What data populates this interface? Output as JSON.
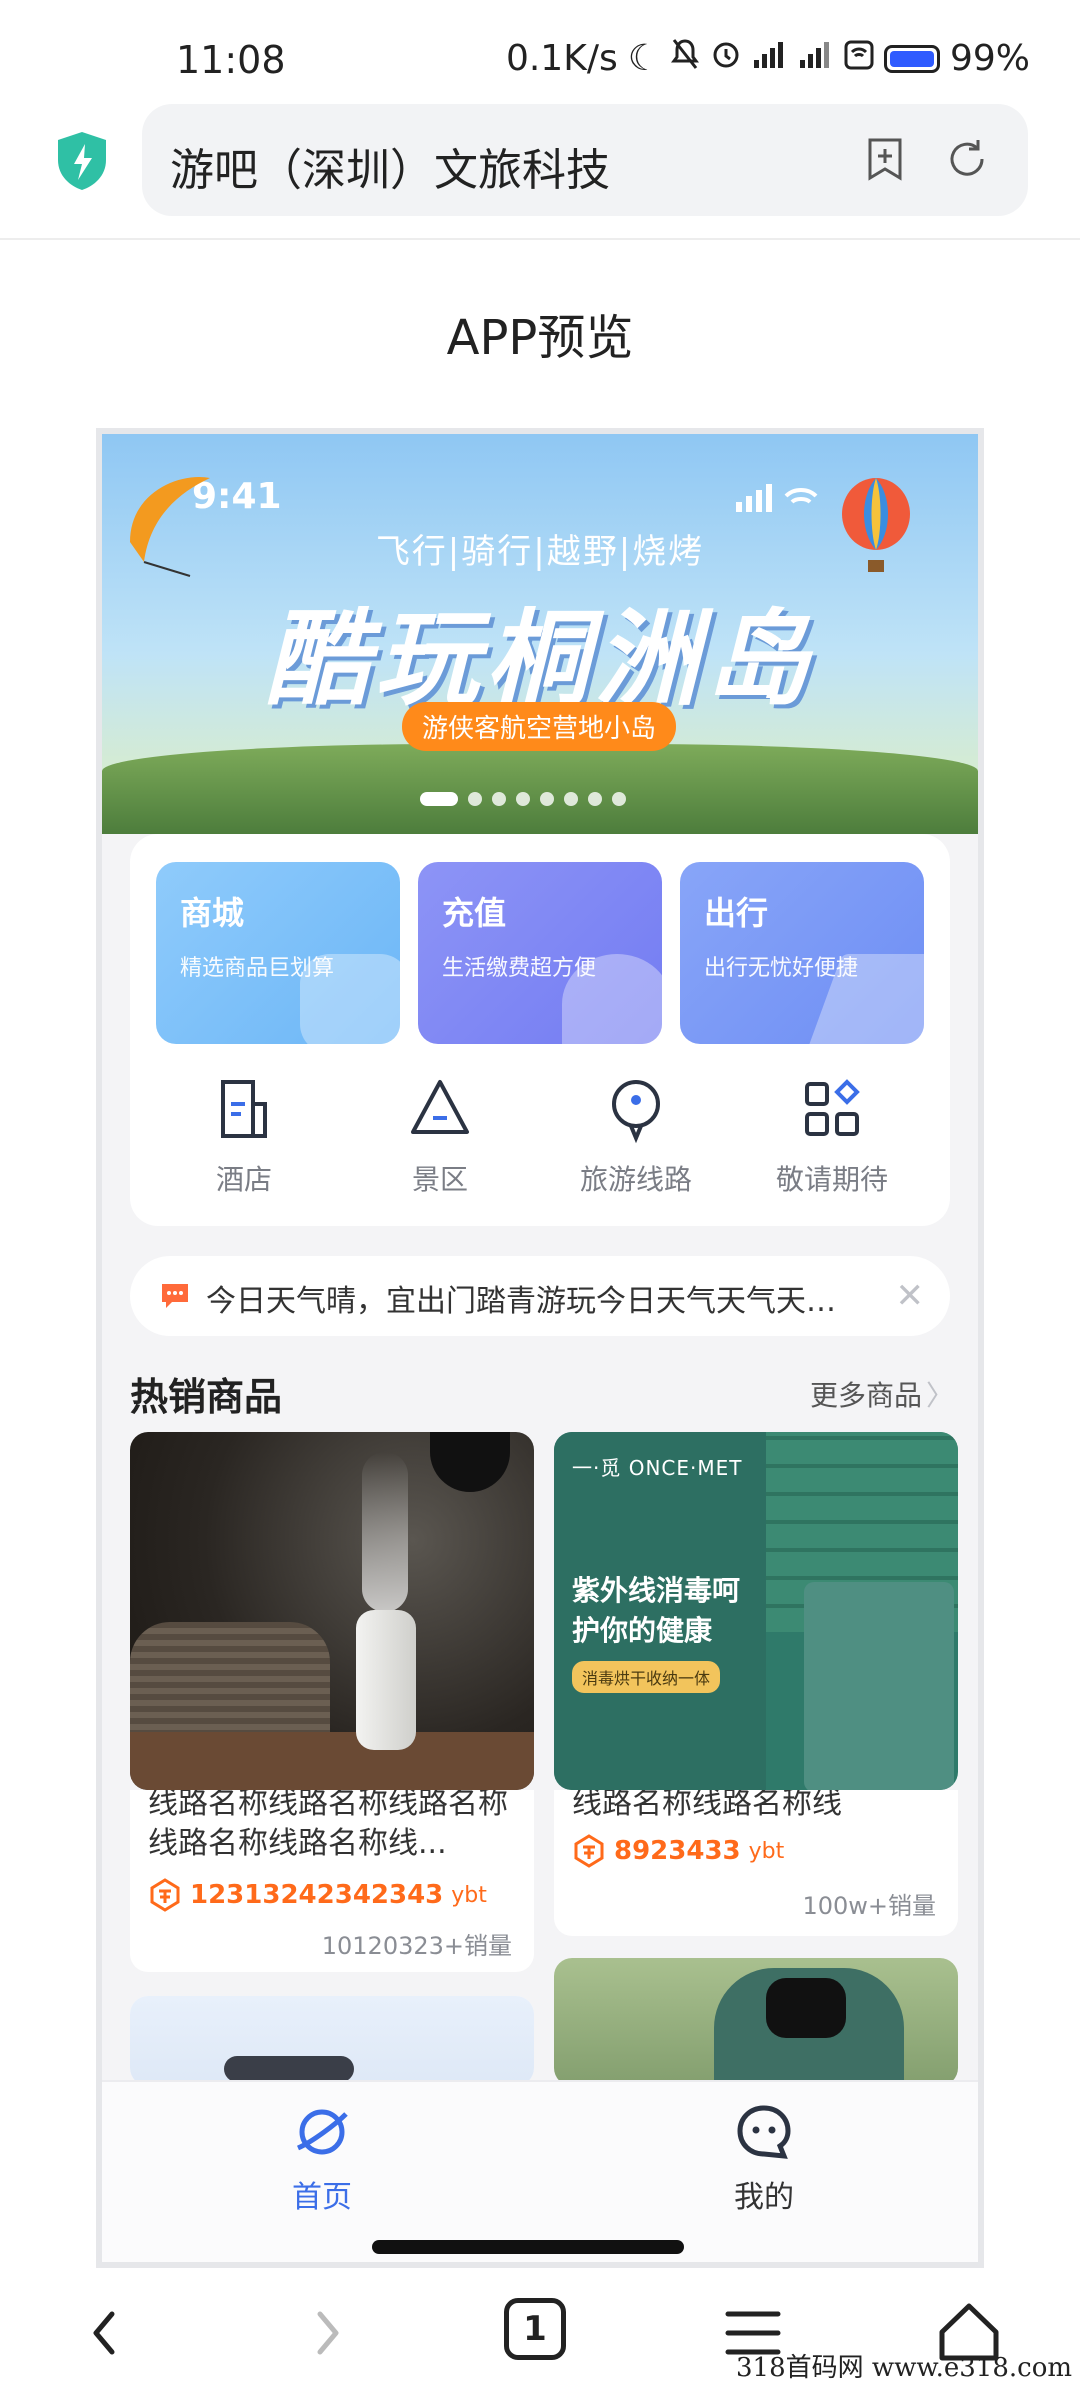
{
  "status_bar": {
    "time": "11:08",
    "net_speed": "0.1K/s",
    "battery": "99%"
  },
  "browser": {
    "url_title": "游吧（深圳）文旅科技",
    "tab_count": "1"
  },
  "page_title": "APP预览",
  "app": {
    "banner": {
      "time": "9:41",
      "subtitle": "飞行|骑行|越野|烧烤",
      "title": "酷玩桐洲岛",
      "tag": "游侠客航空营地小岛",
      "slide_count": 8,
      "active_slide": 1
    },
    "services": [
      {
        "title": "商城",
        "subtitle": "精选商品巨划算"
      },
      {
        "title": "充值",
        "subtitle": "生活缴费超方便"
      },
      {
        "title": "出行",
        "subtitle": "出行无忧好便捷"
      }
    ],
    "quick_links": [
      {
        "label": "酒店",
        "icon": "hotel-icon"
      },
      {
        "label": "景区",
        "icon": "scenic-icon"
      },
      {
        "label": "旅游线路",
        "icon": "route-icon"
      },
      {
        "label": "敬请期待",
        "icon": "apps-icon"
      }
    ],
    "notice": "今日天气晴，宜出门踏青游玩今日天气天气天天天…",
    "hot_section": {
      "title": "热销商品",
      "more": "更多商品"
    },
    "products": [
      {
        "name": "线路名称线路名称线路名称线路名称线路名称线...",
        "price": "12313242342343",
        "unit": "ybt",
        "sold": "10120323+销量"
      },
      {
        "name": "线路名称线路名称线",
        "price": "8923433",
        "unit": "ybt",
        "sold": "100w+销量",
        "image_brand": "一·觅 ONCE·MET",
        "image_headline": "紫外线消毒呵护你的健康",
        "image_pill": "消毒烘干收纳一体"
      }
    ],
    "tabs": [
      {
        "label": "首页",
        "active": true
      },
      {
        "label": "我的",
        "active": false
      }
    ]
  },
  "watermark": "318首码网 www.e318.com",
  "colors": {
    "accent": "#3b6ee8",
    "price": "#ff6a1a",
    "shield": "#2fc0a5"
  }
}
